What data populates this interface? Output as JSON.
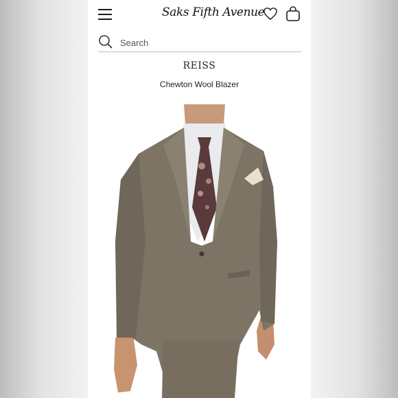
{
  "header": {
    "logo": "Saks Fifth Avenue",
    "menu_icon": "hamburger-menu-icon",
    "wishlist_icon": "heart-icon",
    "bag_icon": "shopping-bag-icon"
  },
  "search": {
    "placeholder": "Search",
    "icon": "search-icon"
  },
  "product": {
    "brand": "REISS",
    "name": "Chewton Wool Blazer",
    "image_alt": "Model wearing grey wool blazer with paisley tie and pocket square"
  },
  "colors": {
    "background": "#ffffff",
    "text": "#222222",
    "divider": "#bdbdbd"
  }
}
